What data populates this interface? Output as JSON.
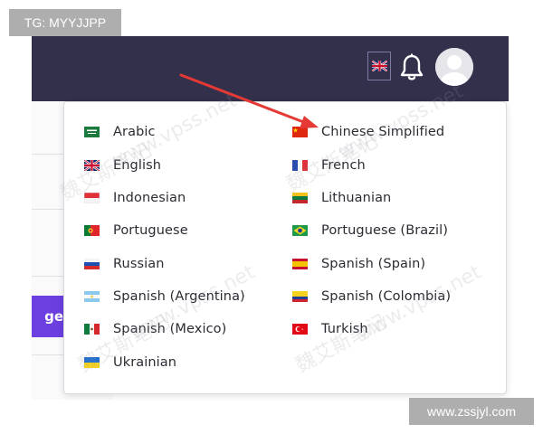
{
  "watermark": {
    "top_left_label": "TG: MYYJJPP",
    "bottom_right_label": "www.zssjyl.com",
    "overlay_texts": [
      "魏艾斯笔记",
      "www.vpss.net"
    ]
  },
  "header": {
    "language_icon": "uk-flag-icon",
    "notification_icon": "bell-icon",
    "avatar_icon": "user-avatar-icon"
  },
  "sidebar": {
    "partial_button_label": "ge"
  },
  "languages": {
    "left": [
      {
        "label": "Arabic",
        "flag": "saudi-flag-icon"
      },
      {
        "label": "English",
        "flag": "uk-flag-icon"
      },
      {
        "label": "Indonesian",
        "flag": "indonesia-flag-icon"
      },
      {
        "label": "Portuguese",
        "flag": "portugal-flag-icon"
      },
      {
        "label": "Russian",
        "flag": "russia-flag-icon"
      },
      {
        "label": "Spanish (Argentina)",
        "flag": "argentina-flag-icon"
      },
      {
        "label": "Spanish (Mexico)",
        "flag": "mexico-flag-icon"
      },
      {
        "label": "Ukrainian",
        "flag": "ukraine-flag-icon"
      }
    ],
    "right": [
      {
        "label": "Chinese Simplified",
        "flag": "china-flag-icon"
      },
      {
        "label": "French",
        "flag": "france-flag-icon"
      },
      {
        "label": "Lithuanian",
        "flag": "lithuania-flag-icon"
      },
      {
        "label": "Portuguese (Brazil)",
        "flag": "brazil-flag-icon"
      },
      {
        "label": "Spanish (Spain)",
        "flag": "spain-flag-icon"
      },
      {
        "label": "Spanish (Colombia)",
        "flag": "colombia-flag-icon"
      },
      {
        "label": "Turkish",
        "flag": "turkey-flag-icon"
      }
    ]
  },
  "colors": {
    "header_bg": "#33304b",
    "accent_purple": "#6b3fe0",
    "arrow_red": "#e53935"
  }
}
